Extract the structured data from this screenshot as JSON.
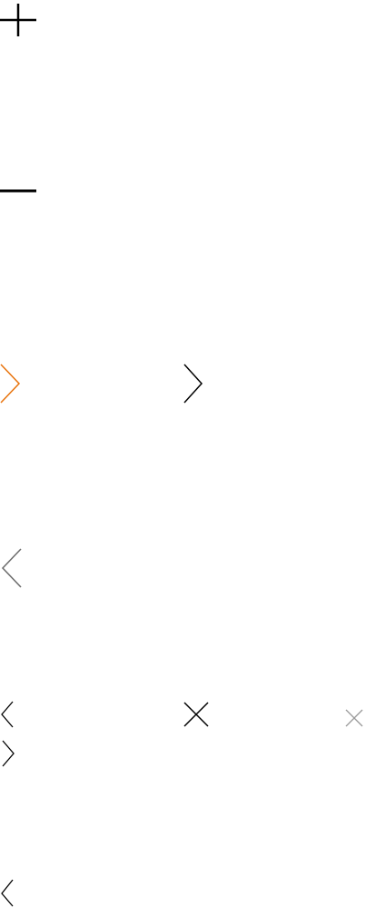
{
  "icons": [
    {
      "id": "plus",
      "name": "plus-icon",
      "color": "#000000"
    },
    {
      "id": "minus",
      "name": "minus-icon",
      "color": "#000000"
    },
    {
      "id": "chev-right-orange",
      "name": "chevron-right-icon",
      "color": "#e8730c"
    },
    {
      "id": "chev-right-black",
      "name": "chevron-right-icon",
      "color": "#000000"
    },
    {
      "id": "chev-left-gray",
      "name": "chevron-left-icon",
      "color": "#6b6b6b"
    },
    {
      "id": "chev-left-small",
      "name": "chevron-left-icon",
      "color": "#000000"
    },
    {
      "id": "close-large",
      "name": "close-icon",
      "color": "#000000"
    },
    {
      "id": "close-small",
      "name": "close-icon",
      "color": "#9a9a9a"
    },
    {
      "id": "chev-right-small",
      "name": "chevron-right-icon",
      "color": "#000000"
    },
    {
      "id": "chev-left-small-2",
      "name": "chevron-left-icon",
      "color": "#000000"
    }
  ]
}
